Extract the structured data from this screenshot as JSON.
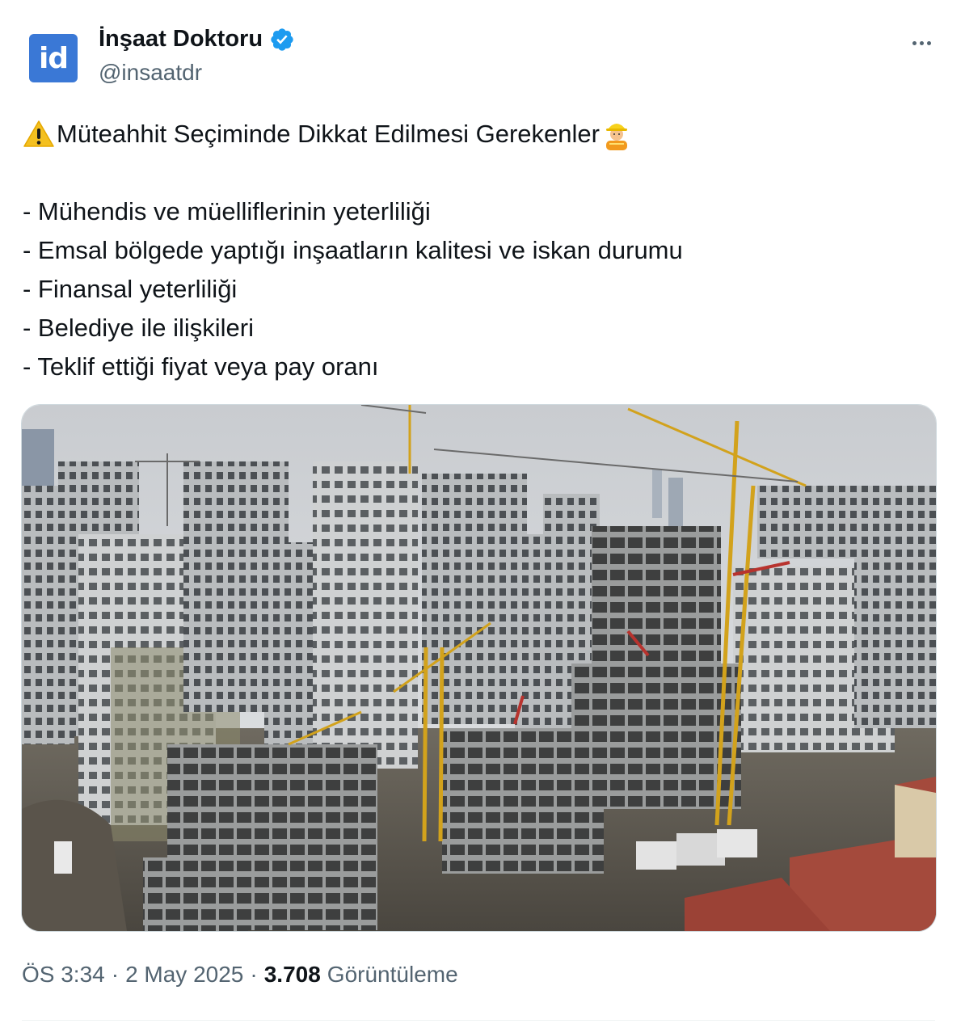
{
  "author": {
    "avatar_text": "id",
    "display_name": "İnşaat Doktoru",
    "handle": "@insaatdr",
    "verified_icon": "verified-badge-icon",
    "brand_color": "#3a78d6",
    "verified_color": "#1d9bf0"
  },
  "tweet": {
    "title": "Müteahhit Seçiminde Dikkat Edilmesi Gerekenler",
    "title_icons": [
      "warning-icon",
      "construction-worker-icon"
    ],
    "items": [
      "- Mühendis ve müelliflerinin yeterliliği",
      "- Emsal bölgede yaptığı inşaatların kalitesi ve iskan durumu",
      "- Finansal yeterliliği",
      "- Belediye ile ilişkileri",
      "- Teklif ettiği fiyat veya pay oranı"
    ]
  },
  "media": {
    "kind": "photo",
    "subject_icon": "construction-site-photo"
  },
  "meta": {
    "time": "ÖS 3:34",
    "separator": "·",
    "date": "2 May 2025",
    "views_count": "3.708",
    "views_label": "Görüntüleme"
  },
  "menu": {
    "icon": "more-options-icon"
  }
}
